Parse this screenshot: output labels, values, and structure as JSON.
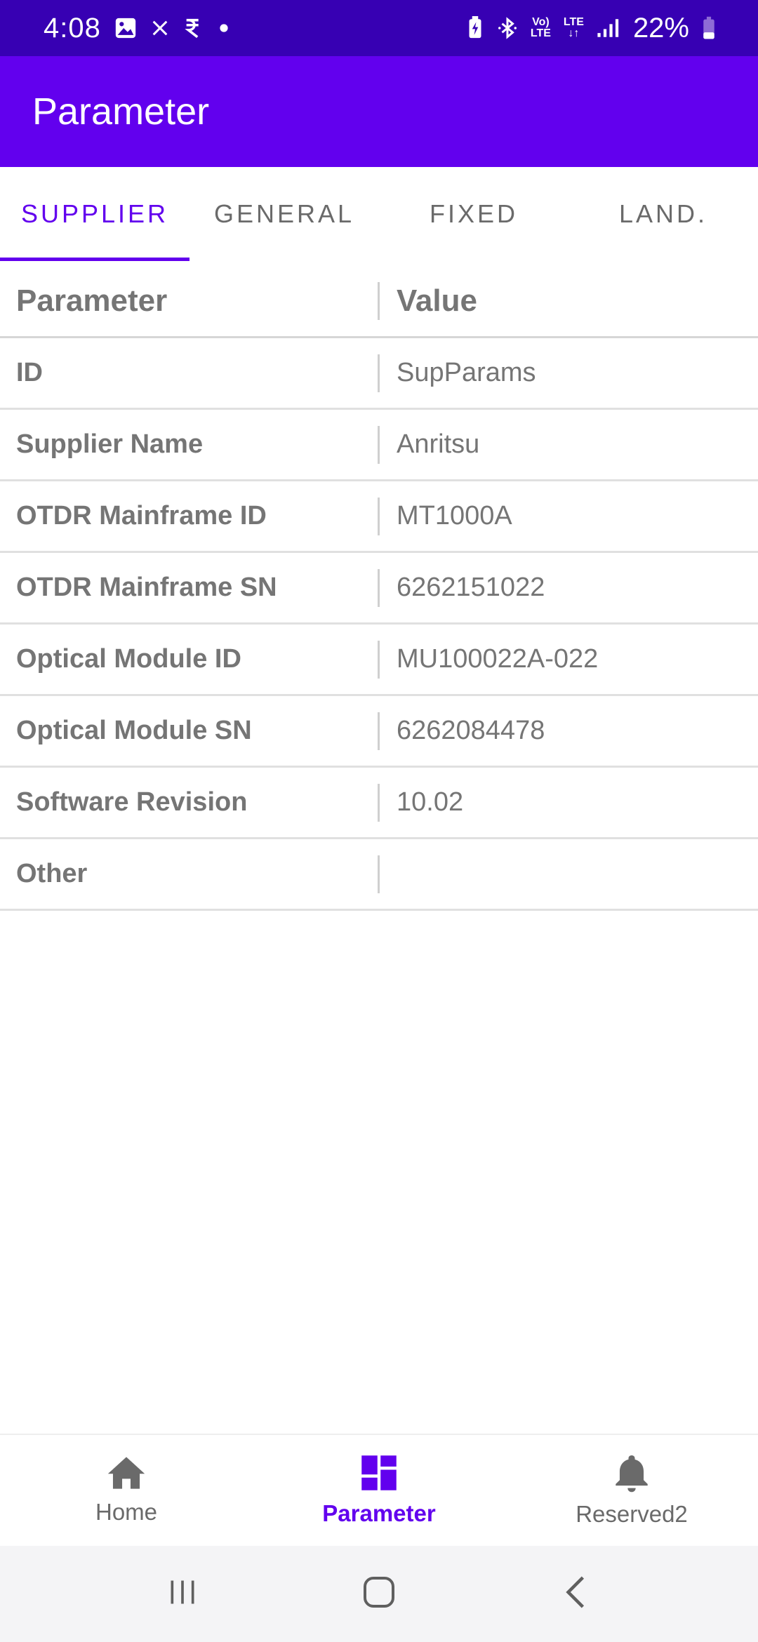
{
  "status_bar": {
    "time": "4:08",
    "battery": "22%",
    "icons": [
      "image-icon",
      "close-x-icon",
      "rupee-notification-icon",
      "dot-icon",
      "battery-saver-icon",
      "bluetooth-icon",
      "volte-icon",
      "lte-icon",
      "signal-icon",
      "battery-icon"
    ],
    "volte_top": "Vo)",
    "volte_bottom": "LTE",
    "lte_label": "LTE"
  },
  "app_bar": {
    "title": "Parameter"
  },
  "tabs": [
    {
      "label": "SUPPLIER",
      "active": true
    },
    {
      "label": "GENERAL",
      "active": false
    },
    {
      "label": "FIXED",
      "active": false
    },
    {
      "label": "LAND.",
      "active": false
    }
  ],
  "table": {
    "header": {
      "parameter": "Parameter",
      "value": "Value"
    },
    "rows": [
      {
        "parameter": "ID",
        "value": "SupParams"
      },
      {
        "parameter": "Supplier Name",
        "value": "Anritsu"
      },
      {
        "parameter": "OTDR Mainframe ID",
        "value": "MT1000A"
      },
      {
        "parameter": "OTDR Mainframe SN",
        "value": "6262151022"
      },
      {
        "parameter": "Optical Module ID",
        "value": "MU100022A-022"
      },
      {
        "parameter": "Optical Module SN",
        "value": "6262084478"
      },
      {
        "parameter": "Software Revision",
        "value": "10.02"
      },
      {
        "parameter": "Other",
        "value": ""
      }
    ]
  },
  "bottom_nav": [
    {
      "label": "Home",
      "icon": "home-icon",
      "active": false
    },
    {
      "label": "Parameter",
      "icon": "dashboard-icon",
      "active": true
    },
    {
      "label": "Reserved2",
      "icon": "bell-icon",
      "active": false
    }
  ],
  "colors": {
    "status_bar": "#3700b3",
    "primary": "#6200ee",
    "text_muted": "#757575"
  }
}
